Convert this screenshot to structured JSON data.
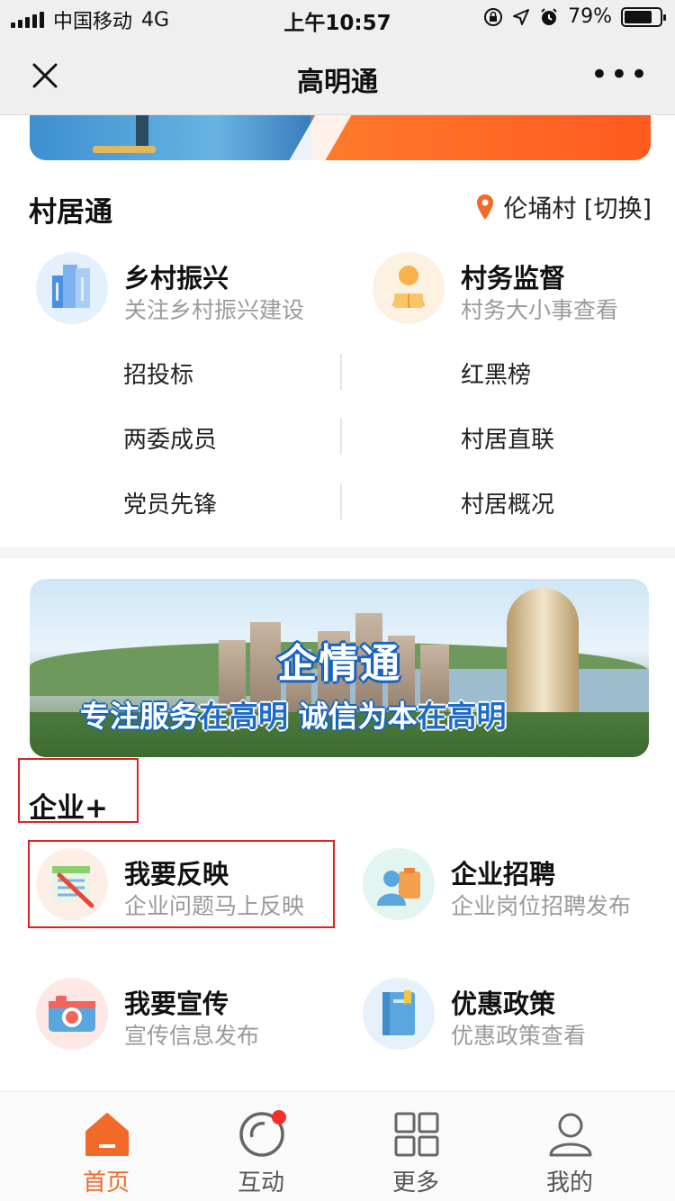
{
  "status_bar": {
    "carrier": "中国移动",
    "network": "4G",
    "time": "上午10:57",
    "battery": "79%",
    "battery_level": 0.79
  },
  "nav": {
    "title": "高明通",
    "more": "•••"
  },
  "village": {
    "title": "村居通",
    "location": "伦埇村 [切换]",
    "features": [
      {
        "name": "乡村振兴",
        "sub": "关注乡村振兴建设",
        "icon": "buildings-icon"
      },
      {
        "name": "村务监督",
        "sub": "村务大小事查看",
        "icon": "person-reading-icon"
      }
    ],
    "links": [
      "招投标",
      "红黑榜",
      "两委成员",
      "村居直联",
      "党员先锋",
      "村居概况"
    ]
  },
  "banner": {
    "title": "企情通",
    "slogan_a": "专注服务",
    "slogan_b": "在高明 ",
    "slogan_c": "诚信为本",
    "slogan_d": "在高明"
  },
  "enterprise": {
    "title": "企业+",
    "features": [
      {
        "name": "我要反映",
        "sub": "企业问题马上反映",
        "icon": "notepad-pen-icon"
      },
      {
        "name": "企业招聘",
        "sub": "企业岗位招聘发布",
        "icon": "recruit-person-icon"
      },
      {
        "name": "我要宣传",
        "sub": "宣传信息发布",
        "icon": "camera-icon"
      },
      {
        "name": "优惠政策",
        "sub": "优惠政策查看",
        "icon": "book-icon"
      }
    ]
  },
  "tabbar": {
    "items": [
      {
        "label": "首页",
        "icon": "home-icon",
        "active": true
      },
      {
        "label": "互动",
        "icon": "interact-icon",
        "badge": true
      },
      {
        "label": "更多",
        "icon": "grid-icon"
      },
      {
        "label": "我的",
        "icon": "user-icon"
      }
    ],
    "active_color": "#f26a2a"
  }
}
